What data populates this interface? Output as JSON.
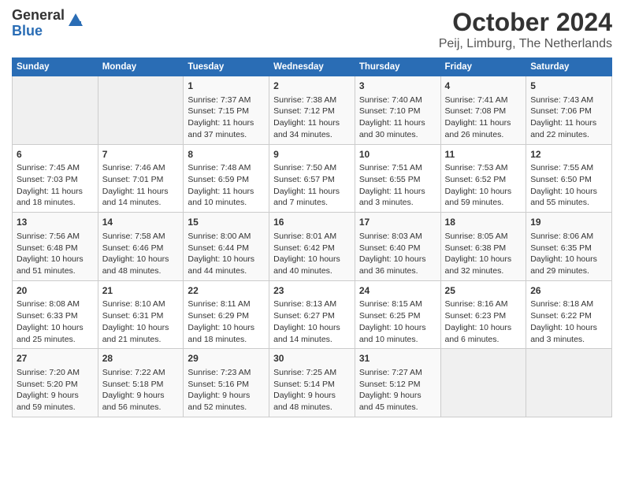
{
  "logo": {
    "line1": "General",
    "line2": "Blue"
  },
  "title": "October 2024",
  "subtitle": "Peij, Limburg, The Netherlands",
  "days_of_week": [
    "Sunday",
    "Monday",
    "Tuesday",
    "Wednesday",
    "Thursday",
    "Friday",
    "Saturday"
  ],
  "weeks": [
    [
      {
        "day": "",
        "sunrise": "",
        "sunset": "",
        "daylight": "",
        "empty": true
      },
      {
        "day": "",
        "sunrise": "",
        "sunset": "",
        "daylight": "",
        "empty": true
      },
      {
        "day": "1",
        "sunrise": "Sunrise: 7:37 AM",
        "sunset": "Sunset: 7:15 PM",
        "daylight": "Daylight: 11 hours and 37 minutes."
      },
      {
        "day": "2",
        "sunrise": "Sunrise: 7:38 AM",
        "sunset": "Sunset: 7:12 PM",
        "daylight": "Daylight: 11 hours and 34 minutes."
      },
      {
        "day": "3",
        "sunrise": "Sunrise: 7:40 AM",
        "sunset": "Sunset: 7:10 PM",
        "daylight": "Daylight: 11 hours and 30 minutes."
      },
      {
        "day": "4",
        "sunrise": "Sunrise: 7:41 AM",
        "sunset": "Sunset: 7:08 PM",
        "daylight": "Daylight: 11 hours and 26 minutes."
      },
      {
        "day": "5",
        "sunrise": "Sunrise: 7:43 AM",
        "sunset": "Sunset: 7:06 PM",
        "daylight": "Daylight: 11 hours and 22 minutes."
      }
    ],
    [
      {
        "day": "6",
        "sunrise": "Sunrise: 7:45 AM",
        "sunset": "Sunset: 7:03 PM",
        "daylight": "Daylight: 11 hours and 18 minutes."
      },
      {
        "day": "7",
        "sunrise": "Sunrise: 7:46 AM",
        "sunset": "Sunset: 7:01 PM",
        "daylight": "Daylight: 11 hours and 14 minutes."
      },
      {
        "day": "8",
        "sunrise": "Sunrise: 7:48 AM",
        "sunset": "Sunset: 6:59 PM",
        "daylight": "Daylight: 11 hours and 10 minutes."
      },
      {
        "day": "9",
        "sunrise": "Sunrise: 7:50 AM",
        "sunset": "Sunset: 6:57 PM",
        "daylight": "Daylight: 11 hours and 7 minutes."
      },
      {
        "day": "10",
        "sunrise": "Sunrise: 7:51 AM",
        "sunset": "Sunset: 6:55 PM",
        "daylight": "Daylight: 11 hours and 3 minutes."
      },
      {
        "day": "11",
        "sunrise": "Sunrise: 7:53 AM",
        "sunset": "Sunset: 6:52 PM",
        "daylight": "Daylight: 10 hours and 59 minutes."
      },
      {
        "day": "12",
        "sunrise": "Sunrise: 7:55 AM",
        "sunset": "Sunset: 6:50 PM",
        "daylight": "Daylight: 10 hours and 55 minutes."
      }
    ],
    [
      {
        "day": "13",
        "sunrise": "Sunrise: 7:56 AM",
        "sunset": "Sunset: 6:48 PM",
        "daylight": "Daylight: 10 hours and 51 minutes."
      },
      {
        "day": "14",
        "sunrise": "Sunrise: 7:58 AM",
        "sunset": "Sunset: 6:46 PM",
        "daylight": "Daylight: 10 hours and 48 minutes."
      },
      {
        "day": "15",
        "sunrise": "Sunrise: 8:00 AM",
        "sunset": "Sunset: 6:44 PM",
        "daylight": "Daylight: 10 hours and 44 minutes."
      },
      {
        "day": "16",
        "sunrise": "Sunrise: 8:01 AM",
        "sunset": "Sunset: 6:42 PM",
        "daylight": "Daylight: 10 hours and 40 minutes."
      },
      {
        "day": "17",
        "sunrise": "Sunrise: 8:03 AM",
        "sunset": "Sunset: 6:40 PM",
        "daylight": "Daylight: 10 hours and 36 minutes."
      },
      {
        "day": "18",
        "sunrise": "Sunrise: 8:05 AM",
        "sunset": "Sunset: 6:38 PM",
        "daylight": "Daylight: 10 hours and 32 minutes."
      },
      {
        "day": "19",
        "sunrise": "Sunrise: 8:06 AM",
        "sunset": "Sunset: 6:35 PM",
        "daylight": "Daylight: 10 hours and 29 minutes."
      }
    ],
    [
      {
        "day": "20",
        "sunrise": "Sunrise: 8:08 AM",
        "sunset": "Sunset: 6:33 PM",
        "daylight": "Daylight: 10 hours and 25 minutes."
      },
      {
        "day": "21",
        "sunrise": "Sunrise: 8:10 AM",
        "sunset": "Sunset: 6:31 PM",
        "daylight": "Daylight: 10 hours and 21 minutes."
      },
      {
        "day": "22",
        "sunrise": "Sunrise: 8:11 AM",
        "sunset": "Sunset: 6:29 PM",
        "daylight": "Daylight: 10 hours and 18 minutes."
      },
      {
        "day": "23",
        "sunrise": "Sunrise: 8:13 AM",
        "sunset": "Sunset: 6:27 PM",
        "daylight": "Daylight: 10 hours and 14 minutes."
      },
      {
        "day": "24",
        "sunrise": "Sunrise: 8:15 AM",
        "sunset": "Sunset: 6:25 PM",
        "daylight": "Daylight: 10 hours and 10 minutes."
      },
      {
        "day": "25",
        "sunrise": "Sunrise: 8:16 AM",
        "sunset": "Sunset: 6:23 PM",
        "daylight": "Daylight: 10 hours and 6 minutes."
      },
      {
        "day": "26",
        "sunrise": "Sunrise: 8:18 AM",
        "sunset": "Sunset: 6:22 PM",
        "daylight": "Daylight: 10 hours and 3 minutes."
      }
    ],
    [
      {
        "day": "27",
        "sunrise": "Sunrise: 7:20 AM",
        "sunset": "Sunset: 5:20 PM",
        "daylight": "Daylight: 9 hours and 59 minutes."
      },
      {
        "day": "28",
        "sunrise": "Sunrise: 7:22 AM",
        "sunset": "Sunset: 5:18 PM",
        "daylight": "Daylight: 9 hours and 56 minutes."
      },
      {
        "day": "29",
        "sunrise": "Sunrise: 7:23 AM",
        "sunset": "Sunset: 5:16 PM",
        "daylight": "Daylight: 9 hours and 52 minutes."
      },
      {
        "day": "30",
        "sunrise": "Sunrise: 7:25 AM",
        "sunset": "Sunset: 5:14 PM",
        "daylight": "Daylight: 9 hours and 48 minutes."
      },
      {
        "day": "31",
        "sunrise": "Sunrise: 7:27 AM",
        "sunset": "Sunset: 5:12 PM",
        "daylight": "Daylight: 9 hours and 45 minutes."
      },
      {
        "day": "",
        "sunrise": "",
        "sunset": "",
        "daylight": "",
        "empty": true
      },
      {
        "day": "",
        "sunrise": "",
        "sunset": "",
        "daylight": "",
        "empty": true
      }
    ]
  ]
}
